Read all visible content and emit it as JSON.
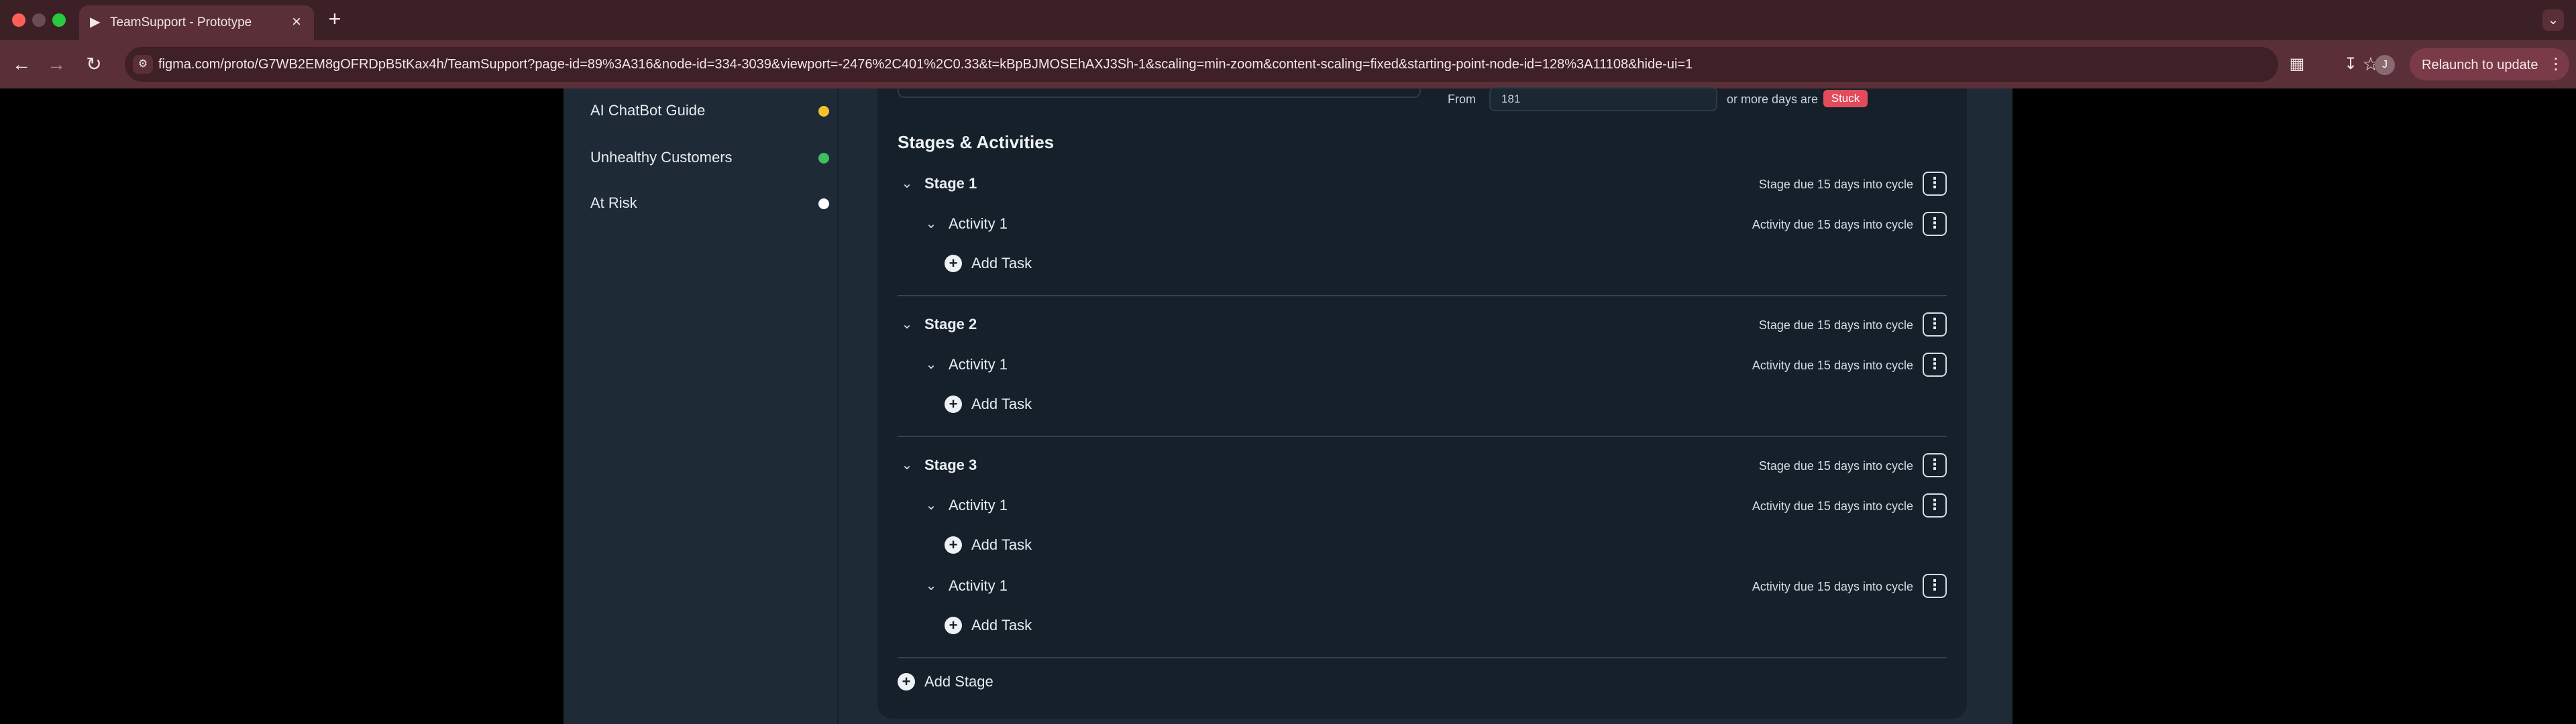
{
  "browser": {
    "tab_title": "TeamSupport - Prototype",
    "url": "figma.com/proto/G7WB2EM8gOFRDpB5tKax4h/TeamSupport?page-id=89%3A316&node-id=334-3039&viewport=-2476%2C401%2C0.33&t=kBpBJMOSEhAXJ3Sh-1&scaling=min-zoom&content-scaling=fixed&starting-point-node-id=128%3A11108&hide-ui=1",
    "avatar_initial": "J",
    "relaunch_label": "Relaunch to update",
    "colors": {
      "titlebar": "#3b2126",
      "toolbar": "#5a2f38",
      "omnibox": "#3e2026"
    }
  },
  "sidebar": {
    "items": [
      {
        "label": "AI ChatBot Guide",
        "status_color": "#f2c12e"
      },
      {
        "label": "Unhealthy Customers",
        "status_color": "#3fbf5f"
      },
      {
        "label": "At Risk",
        "status_color": "#ffffff"
      }
    ]
  },
  "condition": {
    "from_label": "From",
    "from_value": "181",
    "suffix_text": "or more days are",
    "badge": "Stuck",
    "badge_color": "#e24b5c"
  },
  "stages_section": {
    "title": "Stages & Activities",
    "add_task_label": "Add Task",
    "add_stage_label": "Add Stage",
    "stages": [
      {
        "name": "Stage 1",
        "due": "Stage due 15 days into cycle",
        "activities": [
          {
            "name": "Activity 1",
            "due": "Activity due 15 days into cycle"
          }
        ]
      },
      {
        "name": "Stage 2",
        "due": "Stage due 15 days into cycle",
        "activities": [
          {
            "name": "Activity 1",
            "due": "Activity due 15 days into cycle"
          }
        ]
      },
      {
        "name": "Stage 3",
        "due": "Stage due 15 days into cycle",
        "activities": [
          {
            "name": "Activity 1",
            "due": "Activity due 15 days into cycle"
          },
          {
            "name": "Activity 1",
            "due": "Activity due 15 days into cycle"
          }
        ]
      }
    ]
  }
}
